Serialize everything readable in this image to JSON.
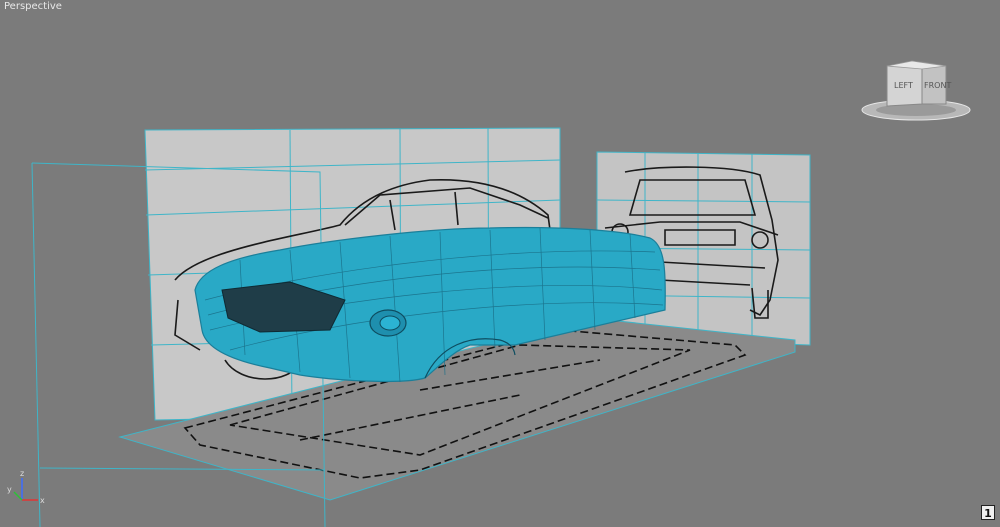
{
  "viewport": {
    "label": "Perspective",
    "background": "#7b7b7b",
    "wire_color": "#3fb5c8",
    "mesh_color": "#29a9c6"
  },
  "viewcube": {
    "left_face": "LEFT",
    "front_face": "FRONT"
  },
  "axes": {
    "x": "x",
    "y": "y",
    "z": "z"
  },
  "viewport_badge": "1"
}
